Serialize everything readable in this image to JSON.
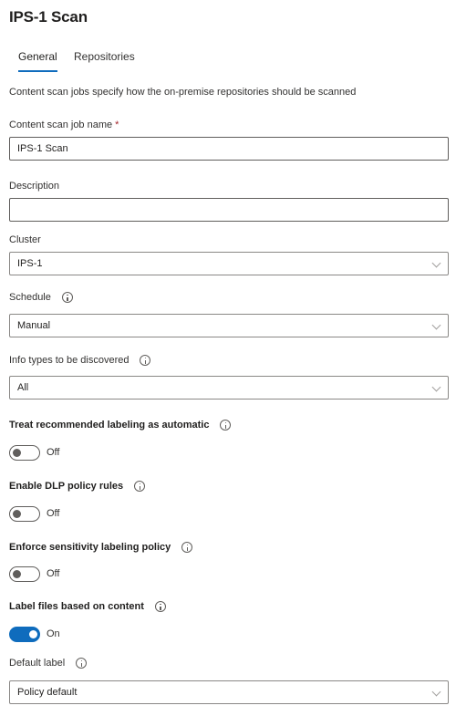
{
  "header": {
    "title": "IPS-1 Scan"
  },
  "tabs": [
    {
      "label": "General",
      "active": true
    },
    {
      "label": "Repositories",
      "active": false
    }
  ],
  "intro": "Content scan jobs specify how the on-premise repositories should be scanned",
  "fields": {
    "job_name": {
      "label": "Content scan job name",
      "required_mark": "*",
      "value": "IPS-1 Scan"
    },
    "description": {
      "label": "Description",
      "value": ""
    },
    "cluster": {
      "label": "Cluster",
      "value": "IPS-1"
    },
    "schedule": {
      "label": "Schedule",
      "value": "Manual"
    },
    "info_types": {
      "label": "Info types to be discovered",
      "value": "All"
    },
    "default_label": {
      "label": "Default label",
      "value": "Policy default"
    }
  },
  "toggles": {
    "recommended_labeling": {
      "label": "Treat recommended labeling as automatic",
      "state": "Off",
      "on": false
    },
    "dlp_rules": {
      "label": "Enable DLP policy rules",
      "state": "Off",
      "on": false
    },
    "enforce_labeling": {
      "label": "Enforce sensitivity labeling policy",
      "state": "Off",
      "on": false
    },
    "label_by_content": {
      "label": "Label files based on content",
      "state": "On",
      "on": true
    }
  },
  "colors": {
    "accent": "#0f6cbd",
    "required": "#a4262c"
  }
}
